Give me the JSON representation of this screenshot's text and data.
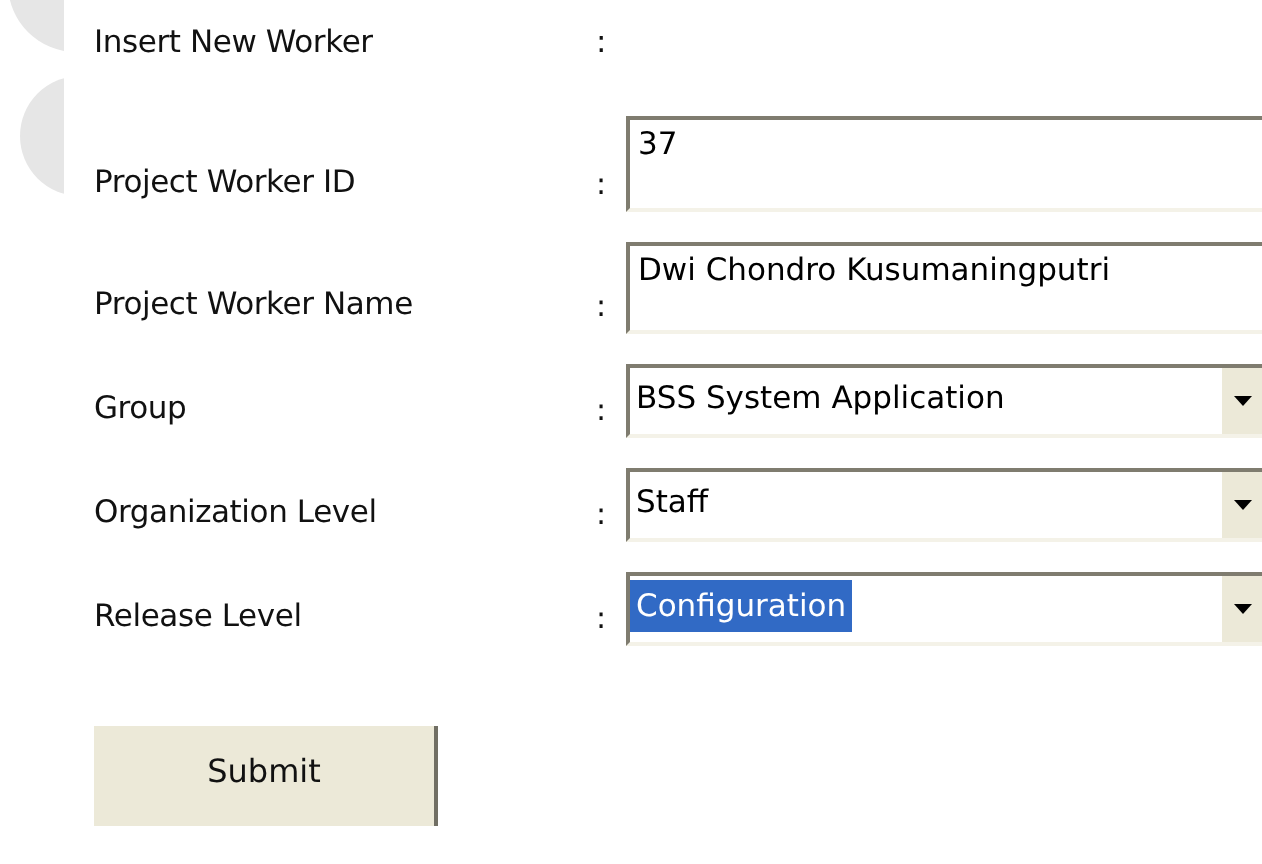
{
  "title": "Insert New Worker",
  "title_separator": ":",
  "fields": [
    {
      "label": "Project Worker ID",
      "separator": ":",
      "kind": "text",
      "value": "37"
    },
    {
      "label": "Project Worker Name",
      "separator": ":",
      "kind": "text",
      "value": "Dwi Chondro Kusumaningputri"
    },
    {
      "label": "Group",
      "separator": ":",
      "kind": "select",
      "value": "BSS System Application",
      "highlighted": false
    },
    {
      "label": "Organization Level",
      "separator": ":",
      "kind": "select",
      "value": "Staff",
      "highlighted": false
    },
    {
      "label": "Release Level",
      "separator": ":",
      "kind": "select",
      "value": "Configuration",
      "highlighted": true
    }
  ],
  "submit": "Submit"
}
